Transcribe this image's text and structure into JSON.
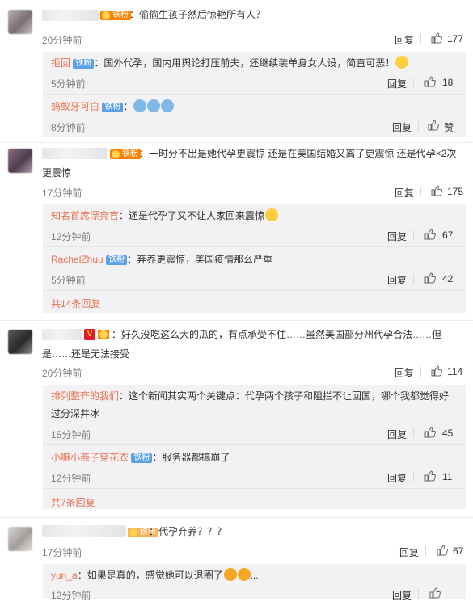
{
  "badges": {
    "fans": "铁粉",
    "v": "V"
  },
  "actions": {
    "reply": "回复",
    "like_zero": "赞"
  },
  "comments": [
    {
      "text": "：偷偷生孩子然后惊艳所有人？",
      "time": "20分钟前",
      "likes": "177",
      "replies": [
        {
          "user": "拒回",
          "text": "：国外代孕，国内用舆论打压前夫，还继续装单身女人设，简直可恶！",
          "time": "5分钟前",
          "likes": "18"
        },
        {
          "user": "蚂蚁牙可白",
          "text": "：",
          "time": "8分钟前",
          "likes": ""
        }
      ],
      "more": ""
    },
    {
      "text": "：一时分不出是她代孕更震惊 还是在美国结婚又离了更震惊 还是代孕×2次更震惊",
      "text_line1": "：一时分不出是她代孕更震惊 还是在美国结婚又离了更震惊 还是代孕×2次",
      "text_line2": "更震惊",
      "time": "17分钟前",
      "likes": "175",
      "replies": [
        {
          "user": "知名首席漂亮官",
          "text": "：还是代孕了又不让人家回来震惊",
          "time": "12分钟前",
          "likes": "67"
        },
        {
          "user": "RachelZhuu",
          "text": "：弃养更震惊，美国疫情那么严重",
          "time": "5分钟前",
          "likes": "42"
        }
      ],
      "more": "共14条回复"
    },
    {
      "text_line1": "：好久没吃这么大的瓜的，有点承受不住……虽然美国部分州代孕合法……但",
      "text_line2": "是……还是无法接受",
      "time": "20分钟前",
      "likes": "114",
      "replies": [
        {
          "user": "排列整齐的我们",
          "text_line1": "：这个新闻其实两个关键点：代孕两个孩子和阻拦不让回国，哪个我都觉得好",
          "text_line2": "过分深井冰",
          "time": "15分钟前",
          "likes": "45"
        },
        {
          "user": "小嘛小燕子穿花衣",
          "text": "：服务器都搞崩了",
          "time": "12分钟前",
          "likes": "11"
        }
      ],
      "more": "共7条回复"
    },
    {
      "text": "：代孕弃养？？？",
      "time": "17分钟前",
      "likes": "67",
      "replies": [
        {
          "user": "yun_a",
          "text": "：如果是真的，感觉她可以退圈了",
          "time": "12分钟前",
          "likes": ""
        }
      ],
      "more": ""
    }
  ]
}
